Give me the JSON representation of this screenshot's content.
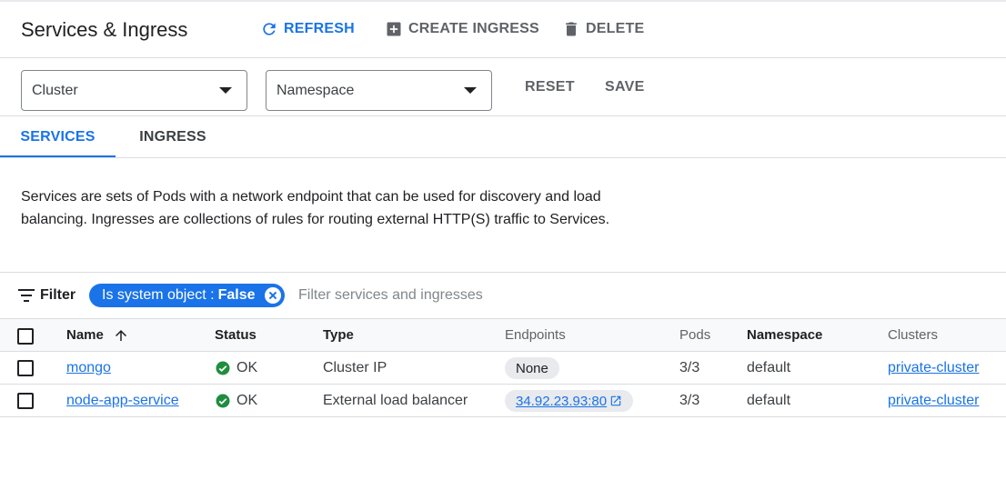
{
  "header": {
    "title": "Services & Ingress",
    "refresh_label": "REFRESH",
    "create_label": "CREATE INGRESS",
    "delete_label": "DELETE"
  },
  "selectors": {
    "cluster_label": "Cluster",
    "namespace_label": "Namespace",
    "reset_label": "RESET",
    "save_label": "SAVE"
  },
  "tabs": {
    "services": "SERVICES",
    "ingress": "INGRESS",
    "active": "SERVICES"
  },
  "description": "Services are sets of Pods with a network endpoint that can be used for discovery and load balancing. Ingresses are collections of rules for routing external HTTP(S) traffic to Services.",
  "filter": {
    "label": "Filter",
    "chip_key": "Is system object :",
    "chip_value": "False",
    "placeholder": "Filter services and ingresses"
  },
  "table": {
    "columns": {
      "name": "Name",
      "status": "Status",
      "type": "Type",
      "endpoints": "Endpoints",
      "pods": "Pods",
      "namespace": "Namespace",
      "clusters": "Clusters"
    },
    "rows": [
      {
        "name": "mongo",
        "status": "OK",
        "type": "Cluster IP",
        "endpoint": "None",
        "pods": "3/3",
        "namespace": "default",
        "cluster": "private-cluster"
      },
      {
        "name": "node-app-service",
        "status": "OK",
        "type": "External load balancer",
        "endpoint": "34.92.23.93:80",
        "pods": "3/3",
        "namespace": "default",
        "cluster": "private-cluster"
      }
    ]
  },
  "colors": {
    "accent": "#1a73e8",
    "ok_green": "#1e8e3e",
    "text": "#202124",
    "muted": "#5f6368"
  },
  "icons": [
    "refresh-icon",
    "add-box-icon",
    "trash-icon",
    "caret-down-icon",
    "filter-icon",
    "close-icon",
    "arrow-up-icon",
    "check-circle-icon",
    "external-link-icon"
  ]
}
